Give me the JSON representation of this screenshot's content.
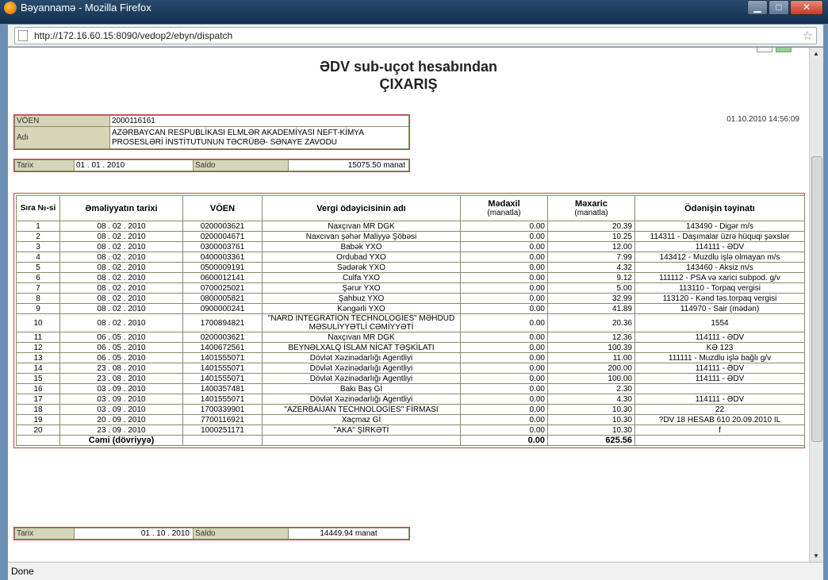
{
  "window": {
    "title": "Bəyannamə - Mozilla Firefox"
  },
  "browser": {
    "url": "http://172.16.60.15:8090/vedop2/ebyn/dispatch",
    "status": "Done"
  },
  "document": {
    "title_line1": "ƏDV sub-uçot hesabından",
    "title_line2": "ÇIXARIŞ",
    "timestamp": "01.10.2010 14:56:09"
  },
  "info": {
    "voen_label": "VÖEN",
    "voen_value": "2000116161",
    "name_label": "Adı",
    "name_value": "AZƏRBAYCAN RESPUBLİKASI ELMLƏR AKADEMİYASI NEFT-KİMYA PROSESLƏRİ İNSTİTUTUNUN TƏCRÜBƏ- SƏNAYE ZAVODU"
  },
  "opening": {
    "date_label": "Tarix",
    "date_value": "01 . 01 . 2010",
    "balance_label": "Saldo",
    "balance_value": "15075.50 manat"
  },
  "closing": {
    "date_label": "Tarix",
    "date_value": "01 . 10 . 2010",
    "balance_label": "Saldo",
    "balance_value": "14449.94 manat"
  },
  "table": {
    "headers": {
      "no": "Sıra №-si",
      "date": "Əməliyyatın tarixi",
      "voen": "VÖEN",
      "payer": "Vergi ödəyicisinin adı",
      "income": "Mədaxil",
      "income_unit": "(manatla)",
      "expense": "Məxaric",
      "expense_unit": "(manatla)",
      "purpose": "Ödənişin təyinatı"
    },
    "rows": [
      [
        "1",
        "08 . 02 . 2010",
        "0200003621",
        "Naxçıvan MR DGK",
        "0.00",
        "20.39",
        "143490 - Digər m/s"
      ],
      [
        "2",
        "08 . 02 . 2010",
        "0200004671",
        "Naxcıvan şəhər Maliyyə Şöbəsi",
        "0.00",
        "10.25",
        "114311 - Daşımalar üzrə hüquqi şəxslər"
      ],
      [
        "3",
        "08 . 02 . 2010",
        "0300003761",
        "Babək YXO",
        "0.00",
        "12.00",
        "114111 - ƏDV"
      ],
      [
        "4",
        "08 . 02 . 2010",
        "0400003361",
        "Ordubad YXO",
        "0.00",
        "7.99",
        "143412 - Muzdlu işlə olmayan m/s"
      ],
      [
        "5",
        "08 . 02 . 2010",
        "0500009191",
        "Sədərək YXO",
        "0.00",
        "4.32",
        "143460 - Aksiz m/s"
      ],
      [
        "6",
        "08 . 02 . 2010",
        "0600012141",
        "Culfa YXO",
        "0.00",
        "9.12",
        "111112 - PSA və xarici subpod. g/v"
      ],
      [
        "7",
        "08 . 02 . 2010",
        "0700025021",
        "Şərur YXO",
        "0.00",
        "5.00",
        "113110 - Torpaq vergisi"
      ],
      [
        "8",
        "08 . 02 . 2010",
        "0800005821",
        "Şahbuz YXO",
        "0.00",
        "32.99",
        "113120 - Kənd təs.torpaq vergisi"
      ],
      [
        "9",
        "08 . 02 . 2010",
        "0900000241",
        "Kəngərli YXO",
        "0.00",
        "41.89",
        "114970 - Sair (mədən)"
      ],
      [
        "10",
        "08 . 02 . 2010",
        "1700894821",
        "\"NARD İNTEGRATİON TECHNOLOGİES\" MƏHDUD MƏSULİYYƏTLİ CƏMİYYƏTİ",
        "0.00",
        "20.36",
        "1554"
      ],
      [
        "11",
        "06 . 05 . 2010",
        "0200003621",
        "Naxçıvan MR DGK",
        "0.00",
        "12.36",
        "114111 - ƏDV"
      ],
      [
        "12",
        "06 . 05 . 2010",
        "1400672561",
        "BEYNƏLXALQ İSLAM NİCAT TƏŞKİLATI",
        "0.00",
        "100.39",
        "KƏ 123"
      ],
      [
        "13",
        "06 . 05 . 2010",
        "1401555071",
        "Dövlət Xəzinədarlığı Agentliyi",
        "0.00",
        "11.00",
        "111111 - Muzdlu işlə bağlı g/v"
      ],
      [
        "14",
        "23 . 08 . 2010",
        "1401555071",
        "Dövlət Xəzinədarlığı Agentliyi",
        "0.00",
        "200.00",
        "114111 - ƏDV"
      ],
      [
        "15",
        "23 . 08 . 2010",
        "1401555071",
        "Dövlət Xəzinədarlığı Agentliyi",
        "0.00",
        "100.00",
        "114111 - ƏDV"
      ],
      [
        "16",
        "03 . 09 . 2010",
        "1400357481",
        "Bakı Baş Gİ",
        "0.00",
        "2.30",
        ""
      ],
      [
        "17",
        "03 . 09 . 2010",
        "1401555071",
        "Dövlət Xəzinədarlığı Agentliyi",
        "0.00",
        "4.30",
        "114111 - ƏDV"
      ],
      [
        "18",
        "03 . 09 . 2010",
        "1700339901",
        "\"AZERBAİJAN TECHNOLOGİES\" FİRMASI",
        "0.00",
        "10.30",
        "22"
      ],
      [
        "19",
        "20 . 09 . 2010",
        "7700116921",
        "Xaçmaz Gİ",
        "0.00",
        "10.30",
        "?DV 18 HESAB 610 20.09.2010 IL"
      ],
      [
        "20",
        "23 . 09 . 2010",
        "1000251171",
        "\"AKA\" ŞİRKƏTİ",
        "0.00",
        "10.30",
        "f"
      ]
    ],
    "total": {
      "label": "Cəmi (dövriyyə)",
      "income": "0.00",
      "expense": "625.56"
    }
  }
}
